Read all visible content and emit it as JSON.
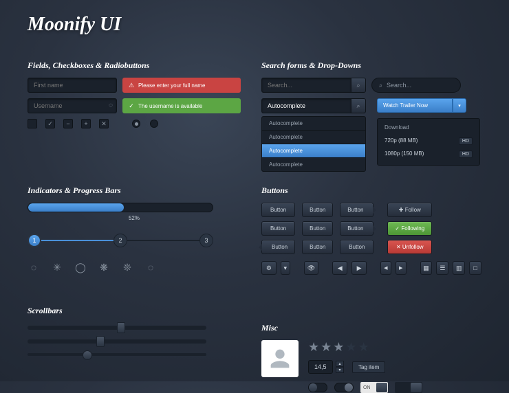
{
  "title": "Moonify UI",
  "sections": {
    "fields": "Fields, Checkboxes & Radiobuttons",
    "indicators": "Indicators & Progress Bars",
    "scrollbars": "Scrollbars",
    "search": "Search forms & Drop-Downs",
    "buttons": "Buttons",
    "misc": "Misc"
  },
  "fields": {
    "first_name_ph": "First name",
    "username_ph": "Username",
    "err_msg": "Please enter your full name",
    "ok_msg": "The username is available"
  },
  "checkbox_glyphs": [
    "",
    "✓",
    "−",
    "+",
    "✕"
  ],
  "progress": {
    "percent": 52,
    "label": "52%"
  },
  "steps": [
    "1",
    "2",
    "3"
  ],
  "search": {
    "placeholder": "Search...",
    "autocomplete": "Autocomplete",
    "dd_items": [
      "Autocomplete",
      "Autocomplete",
      "Autocomplete",
      "Autocomplete"
    ],
    "watch_btn": "Watch Trailer Now",
    "download": "Download",
    "res1": "720p (88 MB)",
    "res2": "1080p (150 MB)",
    "hd": "HD"
  },
  "buttons": {
    "label": "Button",
    "follow": "Follow",
    "following": "Following",
    "unfollow": "Unfollow"
  },
  "misc": {
    "stepper_val": "14,5",
    "tag": "Tag item",
    "on": "ON"
  }
}
